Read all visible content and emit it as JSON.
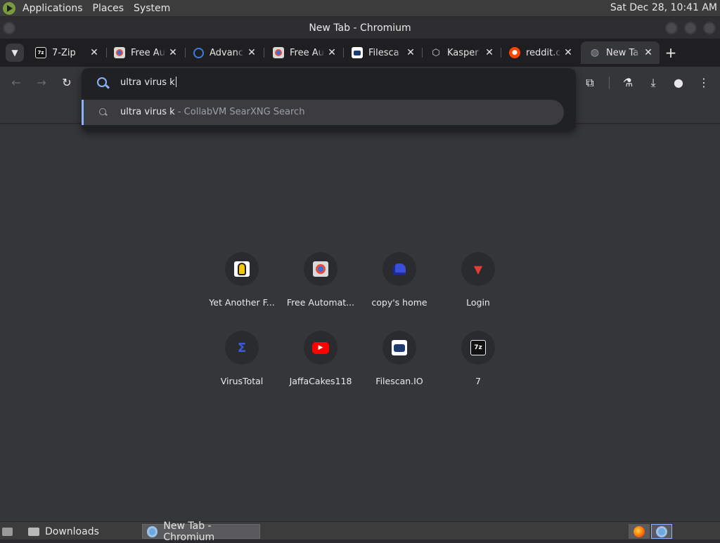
{
  "top_panel": {
    "menus": [
      "Applications",
      "Places",
      "System"
    ],
    "clock": "Sat Dec 28, 10:41 AM"
  },
  "window": {
    "title": "New Tab - Chromium"
  },
  "tabs": [
    {
      "title": "7-Zip",
      "icon": "7zip-icon",
      "color": "#e8e8e8"
    },
    {
      "title": "Free Au",
      "icon": "free-automatic-icon",
      "color": "#4a7fd4"
    },
    {
      "title": "Advanc",
      "icon": "ring-icon",
      "color": "#3b7ddd"
    },
    {
      "title": "Free Au",
      "icon": "free-automatic-icon",
      "color": "#4a7fd4"
    },
    {
      "title": "Filesca",
      "icon": "filescan-icon",
      "color": "#ffffff"
    },
    {
      "title": "Kasper",
      "icon": "kaspersky-icon",
      "color": "#cfd8dc"
    },
    {
      "title": "reddit.c",
      "icon": "reddit-icon",
      "color": "#ff4500"
    },
    {
      "title": "New Ta",
      "icon": "globe-icon",
      "color": "#9aa0a6",
      "active": true
    }
  ],
  "omnibox": {
    "text": "ultra virus k",
    "suggestion": {
      "query": "ultra virus k",
      "source": " - CollabVM SearXNG Search"
    }
  },
  "shortcuts": [
    {
      "label": "Yet Another F...",
      "icon": "cartoon-guy-icon"
    },
    {
      "label": "Free Automat...",
      "icon": "free-automatic-icon"
    },
    {
      "label": "copy's home",
      "icon": "pixel-ghost-icon"
    },
    {
      "label": "Login",
      "icon": "red-wings-icon"
    },
    {
      "label": "VirusTotal",
      "icon": "virustotal-icon"
    },
    {
      "label": "JaffaCakes118",
      "icon": "youtube-icon"
    },
    {
      "label": "Filescan.IO",
      "icon": "filescan-icon"
    },
    {
      "label": "7",
      "icon": "7zip-icon"
    }
  ],
  "taskbar": {
    "items": [
      {
        "label": "Downloads",
        "icon": "folder-icon"
      },
      {
        "label": "New Tab - Chromium",
        "icon": "chromium-icon",
        "active": true
      }
    ]
  }
}
